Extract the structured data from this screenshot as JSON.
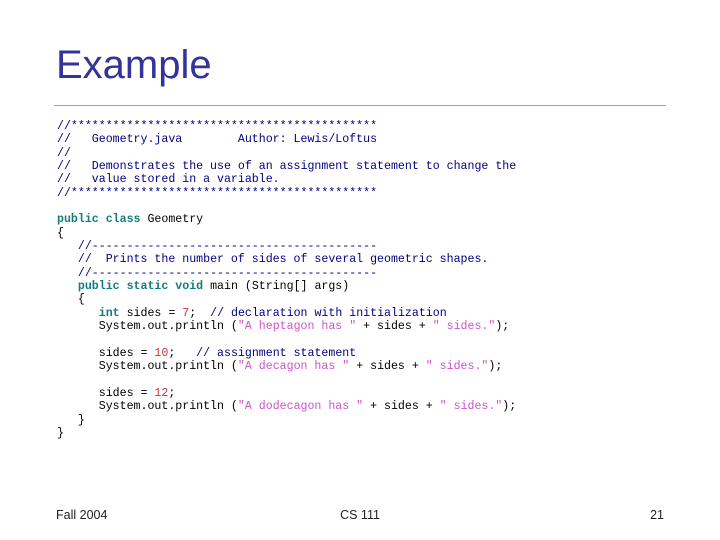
{
  "slide": {
    "title": "Example",
    "footer": {
      "left": "Fall 2004",
      "center": "CS 111",
      "right": "21"
    },
    "colors": {
      "title": "#333399",
      "rule": "#8ba9bd",
      "comment": "#000080",
      "keyword": "#137c7c",
      "string": "#cc55cc",
      "number": "#cc3333",
      "plain": "#000000"
    }
  },
  "code": {
    "language": "java",
    "lines": [
      [
        {
          "t": "comment",
          "s": "//********************************************"
        }
      ],
      [
        {
          "t": "comment",
          "s": "//   Geometry.java        Author: Lewis/Loftus"
        }
      ],
      [
        {
          "t": "comment",
          "s": "//"
        }
      ],
      [
        {
          "t": "comment",
          "s": "//   Demonstrates the use of an assignment statement to change the"
        }
      ],
      [
        {
          "t": "comment",
          "s": "//   value stored in a variable."
        }
      ],
      [
        {
          "t": "comment",
          "s": "//********************************************"
        }
      ],
      [
        {
          "t": "plain",
          "s": ""
        }
      ],
      [
        {
          "t": "keyword",
          "s": "public class "
        },
        {
          "t": "plain",
          "s": "Geometry"
        }
      ],
      [
        {
          "t": "plain",
          "s": "{"
        }
      ],
      [
        {
          "t": "plain",
          "s": "   "
        },
        {
          "t": "comment",
          "s": "//-----------------------------------------"
        }
      ],
      [
        {
          "t": "plain",
          "s": "   "
        },
        {
          "t": "comment",
          "s": "//  Prints the number of sides of several geometric shapes."
        }
      ],
      [
        {
          "t": "plain",
          "s": "   "
        },
        {
          "t": "comment",
          "s": "//-----------------------------------------"
        }
      ],
      [
        {
          "t": "plain",
          "s": "   "
        },
        {
          "t": "keyword",
          "s": "public static void "
        },
        {
          "t": "plain",
          "s": "main (String[] args)"
        }
      ],
      [
        {
          "t": "plain",
          "s": "   {"
        }
      ],
      [
        {
          "t": "plain",
          "s": "      "
        },
        {
          "t": "keyword",
          "s": "int "
        },
        {
          "t": "plain",
          "s": "sides = "
        },
        {
          "t": "number",
          "s": "7"
        },
        {
          "t": "plain",
          "s": ";  "
        },
        {
          "t": "comment",
          "s": "// declaration with initialization"
        }
      ],
      [
        {
          "t": "plain",
          "s": "      System.out.println ("
        },
        {
          "t": "string",
          "s": "\"A heptagon has \""
        },
        {
          "t": "plain",
          "s": " + sides + "
        },
        {
          "t": "string",
          "s": "\" sides.\""
        },
        {
          "t": "plain",
          "s": ");"
        }
      ],
      [
        {
          "t": "plain",
          "s": ""
        }
      ],
      [
        {
          "t": "plain",
          "s": "      sides = "
        },
        {
          "t": "number",
          "s": "10"
        },
        {
          "t": "plain",
          "s": ";   "
        },
        {
          "t": "comment",
          "s": "// assignment statement"
        }
      ],
      [
        {
          "t": "plain",
          "s": "      System.out.println ("
        },
        {
          "t": "string",
          "s": "\"A decagon has \""
        },
        {
          "t": "plain",
          "s": " + sides + "
        },
        {
          "t": "string",
          "s": "\" sides.\""
        },
        {
          "t": "plain",
          "s": ");"
        }
      ],
      [
        {
          "t": "plain",
          "s": ""
        }
      ],
      [
        {
          "t": "plain",
          "s": "      sides = "
        },
        {
          "t": "number",
          "s": "12"
        },
        {
          "t": "plain",
          "s": ";"
        }
      ],
      [
        {
          "t": "plain",
          "s": "      System.out.println ("
        },
        {
          "t": "string",
          "s": "\"A dodecagon has \""
        },
        {
          "t": "plain",
          "s": " + sides + "
        },
        {
          "t": "string",
          "s": "\" sides.\""
        },
        {
          "t": "plain",
          "s": ");"
        }
      ],
      [
        {
          "t": "plain",
          "s": "   }"
        }
      ],
      [
        {
          "t": "plain",
          "s": "}"
        }
      ]
    ]
  }
}
